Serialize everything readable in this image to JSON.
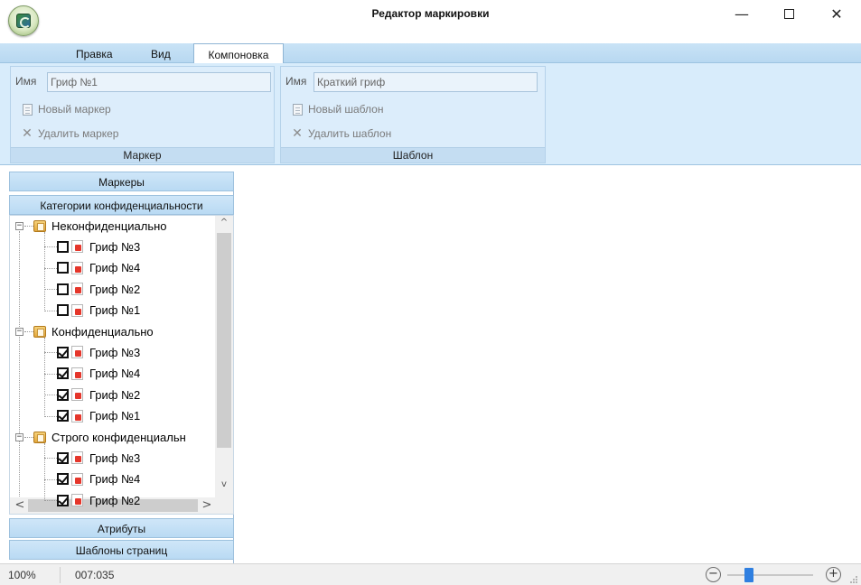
{
  "window": {
    "title": "Редактор маркировки",
    "min_glyph": "—",
    "close_glyph": "✕"
  },
  "menu": {
    "tabs": [
      {
        "label": "Правка"
      },
      {
        "label": "Вид"
      },
      {
        "label": "Компоновка",
        "active": true
      }
    ]
  },
  "ribbon": {
    "marker_group": {
      "name_label": "Имя",
      "name_value": "Гриф №1",
      "new_label": "Новый маркер",
      "delete_label": "Удалить маркер",
      "caption": "Маркер"
    },
    "template_group": {
      "name_label": "Имя",
      "name_value": "Краткий гриф",
      "new_label": "Новый шаблон",
      "delete_label": "Удалить шаблон",
      "caption": "Шаблон"
    }
  },
  "left_panel": {
    "headers": {
      "markers": "Маркеры",
      "categories": "Категории конфиденциальности",
      "attributes": "Атрибуты",
      "page_templates": "Шаблоны страниц"
    },
    "tree": [
      {
        "label": "Неконфиденциально",
        "expanded": true,
        "children": [
          {
            "label": "Гриф №3",
            "checked": false
          },
          {
            "label": "Гриф №4",
            "checked": false
          },
          {
            "label": "Гриф №2",
            "checked": false
          },
          {
            "label": "Гриф №1",
            "checked": false
          }
        ]
      },
      {
        "label": "Конфиденциально",
        "expanded": true,
        "children": [
          {
            "label": "Гриф №3",
            "checked": true
          },
          {
            "label": "Гриф №4",
            "checked": true
          },
          {
            "label": "Гриф №2",
            "checked": true
          },
          {
            "label": "Гриф №1",
            "checked": true
          }
        ]
      },
      {
        "label": "Строго конфиденциальн",
        "expanded": true,
        "children": [
          {
            "label": "Гриф №3",
            "checked": true
          },
          {
            "label": "Гриф №4",
            "checked": true
          },
          {
            "label": "Гриф №2",
            "checked": true
          }
        ]
      }
    ],
    "scroll": {
      "up": "^",
      "down": "v",
      "left": "<",
      "right": ">"
    }
  },
  "status": {
    "zoom": "100%",
    "position": "007:035",
    "zoom_out": "−",
    "zoom_in": "+",
    "zoom_level": 0.25
  },
  "colors": {
    "ribbon_bg": "#d8ecfb",
    "accent": "#2f7fe0",
    "grif_icon": "#e5362b"
  }
}
